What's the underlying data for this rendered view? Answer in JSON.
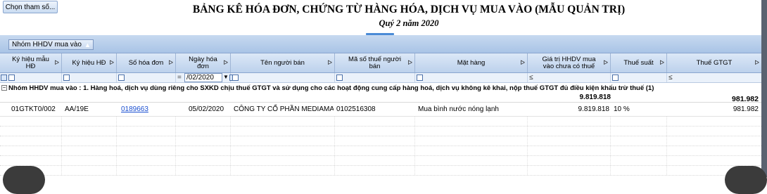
{
  "toolbar": {
    "params_button": "Chọn tham số..."
  },
  "report": {
    "title": "BẢNG KÊ HÓA ĐƠN, CHỨNG TỪ HÀNG HÓA, DỊCH VỤ MUA VÀO (MẪU QUẢN TRỊ)",
    "period": "Quý 2 năm 2020"
  },
  "grouping": {
    "chip_label": "Nhóm HHDV mua vào",
    "chip_sort_icon": "sort-up-icon"
  },
  "columns": [
    {
      "label": "Ký hiệu mẫu HĐ"
    },
    {
      "label": "Ký hiệu HĐ"
    },
    {
      "label": "Số hóa đơn"
    },
    {
      "label": "Ngày hóa đơn"
    },
    {
      "label": "Tên người bán"
    },
    {
      "label": "Mã số thuế người bán"
    },
    {
      "label": "Mặt hàng"
    },
    {
      "label": "Giá trị HHDV mua vào chưa có thuế"
    },
    {
      "label": "Thuế suất"
    },
    {
      "label": "Thuế GTGT"
    }
  ],
  "filter": {
    "date_value": "/02/2020",
    "date_operator": "=",
    "le_operator": "≤"
  },
  "group": {
    "toggle": "−",
    "text": "Nhóm HHDV mua vào : 1. Hàng hoá, dịch vụ dùng riêng cho SXKD chịu thuế GTGT và sử dụng cho các hoạt động cung cấp hàng hoá, dịch vụ không kê khai, nộp thuế GTGT đủ điều kiện khấu trừ thuế (1)",
    "sum_value": "9.819.818",
    "sum_tax": "981.982"
  },
  "rows": [
    {
      "mau": "01GTKT0/002",
      "kyhieu": "AA/19E",
      "so": "0189663",
      "ngay": "05/02/2020",
      "nguoiban": "CÔNG TY CỔ PHẦN MEDIAMAR",
      "mst": "0102516308",
      "mathang": "Mua bình nước nóng lạnh",
      "giatri": "9.819.818",
      "thuesuat": "10 %",
      "thue": "981.982"
    }
  ],
  "colors": {
    "header_bg": "#bcd1ec",
    "group_bar_bg": "#a9c4e6",
    "link": "#1a4fd1"
  }
}
